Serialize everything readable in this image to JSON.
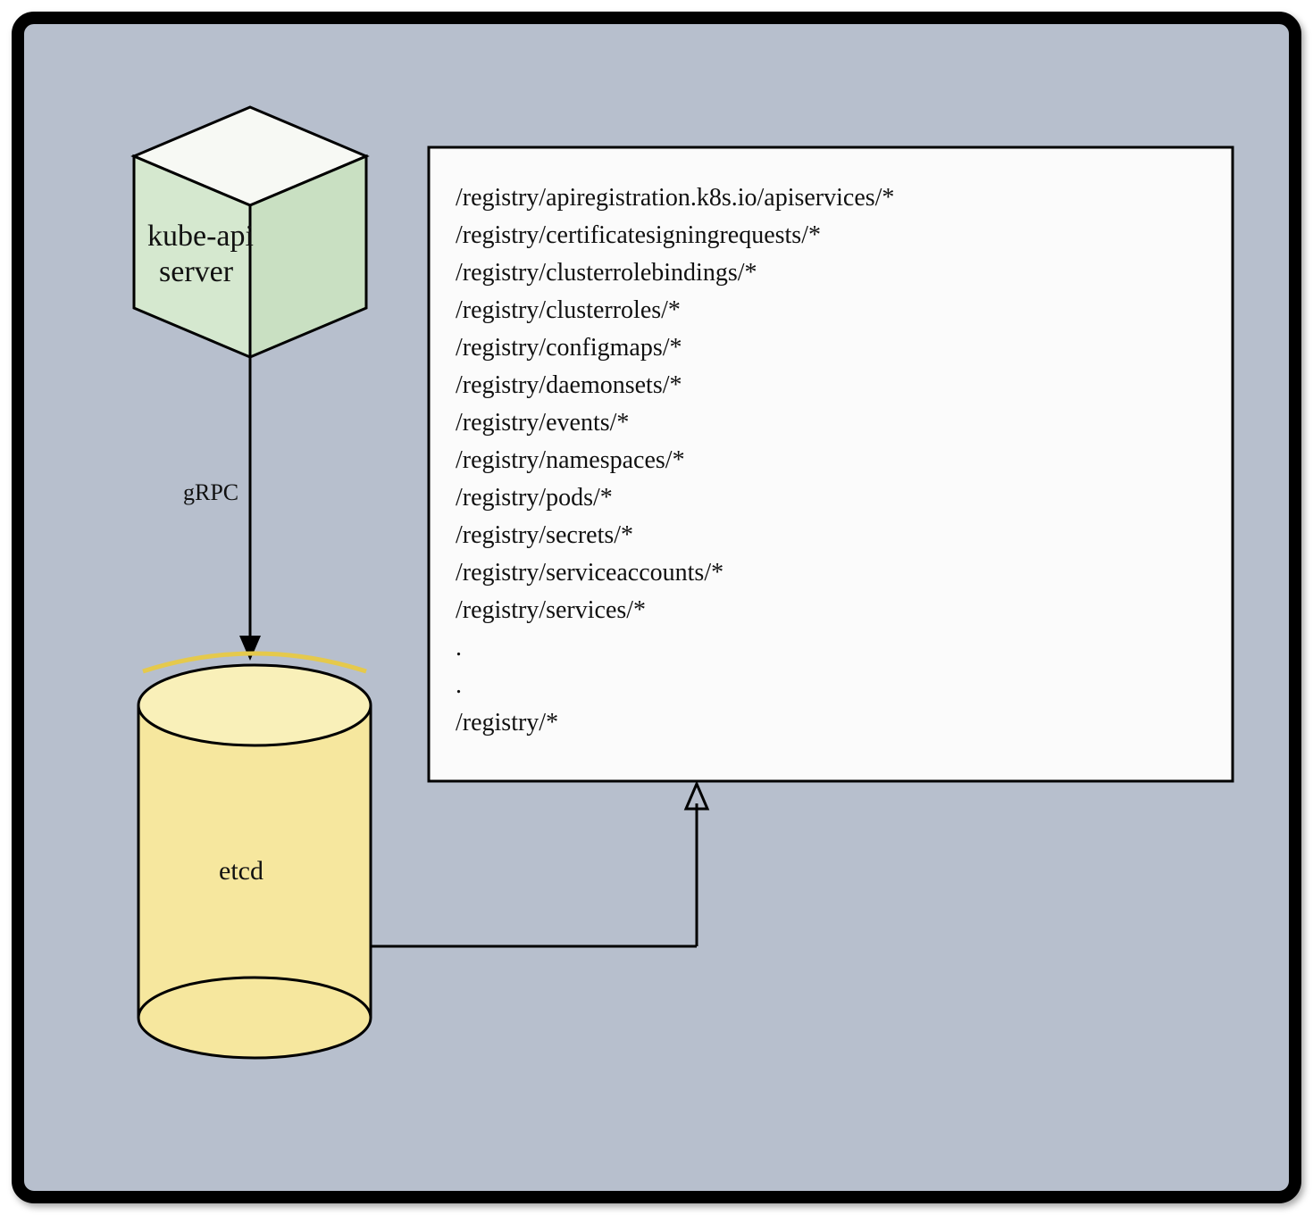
{
  "diagram": {
    "kube_api": {
      "line1": "kube-api",
      "line2": "server"
    },
    "connector_label": "gRPC",
    "etcd_label": "etcd",
    "registry_paths": [
      "/registry/apiregistration.k8s.io/apiservices/*",
      "/registry/certificatesigningrequests/*",
      "/registry/clusterrolebindings/*",
      "/registry/clusterroles/*",
      "/registry/configmaps/*",
      "/registry/daemonsets/*",
      "/registry/events/*",
      "/registry/namespaces/*",
      "/registry/pods/*",
      "/registry/secrets/*",
      "/registry/serviceaccounts/*",
      "/registry/services/*",
      ".",
      ".",
      "/registry/*"
    ]
  }
}
